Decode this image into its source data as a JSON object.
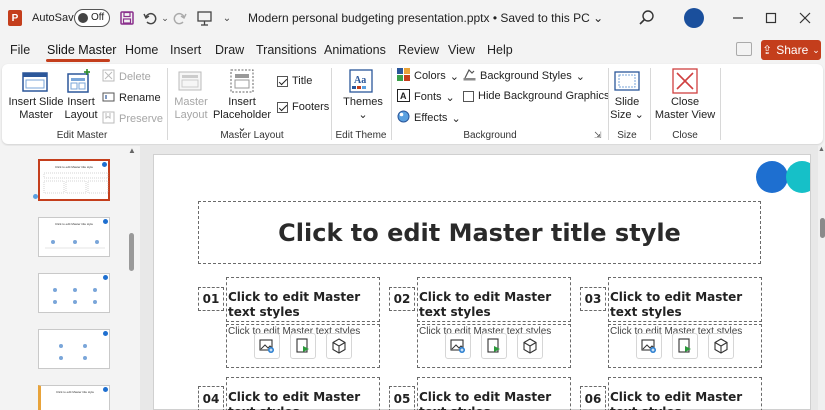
{
  "titlebar": {
    "autosave_label": "AutoSave",
    "autosave_state": "Off",
    "document_title": "Modern personal budgeting presentation.pptx • Saved to this PC ⌄"
  },
  "menu": {
    "tabs": [
      "File",
      "Slide Master",
      "Home",
      "Insert",
      "Draw",
      "Transitions",
      "Animations",
      "Review",
      "View",
      "Help"
    ],
    "active_tab": "Slide Master",
    "share_label": "Share"
  },
  "ribbon": {
    "edit_master": {
      "group_label": "Edit Master",
      "insert_slide_master": "Insert Slide Master",
      "insert_layout": "Insert Layout",
      "delete": "Delete",
      "rename": "Rename",
      "preserve": "Preserve"
    },
    "master_layout": {
      "group_label": "Master Layout",
      "master_layout": "Master Layout",
      "insert_placeholder": "Insert Placeholder",
      "title": "Title",
      "footers": "Footers",
      "title_checked": true,
      "footers_checked": true
    },
    "edit_theme": {
      "group_label": "Edit Theme",
      "themes": "Themes"
    },
    "background": {
      "group_label": "Background",
      "colors": "Colors",
      "fonts": "Fonts",
      "effects": "Effects",
      "background_styles": "Background Styles",
      "hide_background_graphics": "Hide Background Graphics",
      "hide_checked": false
    },
    "size": {
      "group_label": "Size",
      "slide_size": "Slide Size"
    },
    "close": {
      "group_label": "Close",
      "close_master_view": "Close Master View"
    }
  },
  "slide": {
    "title": "Click to edit Master title style",
    "columns": [
      {
        "number": "01",
        "text": "Click to edit Master text styles",
        "sub": "Click to edit Master text styles"
      },
      {
        "number": "02",
        "text": "Click to edit Master text styles",
        "sub": "Click to edit Master text styles"
      },
      {
        "number": "03",
        "text": "Click to edit Master text styles",
        "sub": "Click to edit Master text styles"
      },
      {
        "number": "04",
        "text": "Click to edit Master text styles"
      },
      {
        "number": "05",
        "text": "Click to edit Master text styles"
      },
      {
        "number": "06",
        "text": "Click to edit Master text styles"
      }
    ]
  },
  "thumbnails": {
    "caption": "Click to edit Master title style"
  },
  "colors": {
    "accent": "#c43e1c",
    "circle_blue": "#1e6fd0",
    "circle_teal": "#16c0c8",
    "avatar": "#1a4f9c"
  }
}
